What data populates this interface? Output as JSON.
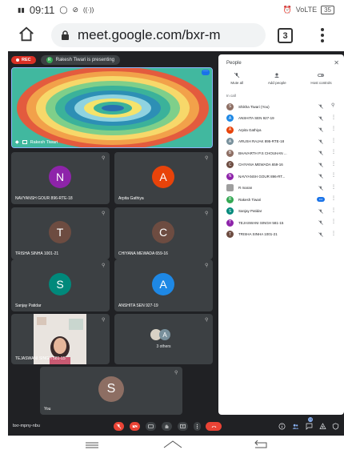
{
  "status_bar": {
    "time": "09:11",
    "left_icons": [
      "signal-icon",
      "whatsapp-icon",
      "shield-icon",
      "hotspot-icon"
    ],
    "right_text": "VoLTE",
    "battery": "35"
  },
  "browser": {
    "url": "meet.google.com/bxr-m",
    "tabs_count": "3"
  },
  "meeting": {
    "rec_label": "REC",
    "presenter_initial": "R",
    "presenting_text": "Rakesh Tiwari is presenting",
    "screen_share_label": "Rakesh Tiwari",
    "meeting_code": "bxr-mpny-nbu"
  },
  "tiles": [
    {
      "name": "NAVYANSH GOUR 896-RTE-18",
      "initial": "N",
      "color": "#8e24aa"
    },
    {
      "name": "Arpita Gathiya",
      "initial": "A",
      "color": "#e8430a"
    },
    {
      "name": "TRISHA SINHA 1001-21",
      "initial": "T",
      "color": "#6d4c41"
    },
    {
      "name": "CHIYANA MEWADA 659-16",
      "initial": "C",
      "color": "#6d4c41"
    },
    {
      "name": "Sanjay Patidar",
      "initial": "S",
      "color": "#00897b"
    },
    {
      "name": "ANSHITA SEN 927-19",
      "initial": "A",
      "color": "#1e88e5"
    },
    {
      "name": "TEJASWANI SINGH 581-15",
      "initial": "",
      "color": ""
    },
    {
      "name": "3 others",
      "initial": "A",
      "color": "#78909c"
    },
    {
      "name": "You",
      "initial": "S",
      "color": "#8d6e63"
    }
  ],
  "people_panel": {
    "title": "People",
    "actions": [
      "Mute all",
      "Add people",
      "Host controls"
    ],
    "section": "In call",
    "participants": [
      {
        "name": "Shikha Tiwari (You)",
        "initial": "S",
        "color": "#8d6e63"
      },
      {
        "name": "ANSHITA SEN 927-19",
        "initial": "A",
        "color": "#1e88e5"
      },
      {
        "name": "Arpita Gathiya",
        "initial": "A",
        "color": "#e8430a"
      },
      {
        "name": "ARUSH RAJAK 895-RTE-18",
        "initial": "A",
        "color": "#78909c"
      },
      {
        "name": "BHAVARTH P.S CHOUHAN ...",
        "initial": "B",
        "color": "#8d6e63"
      },
      {
        "name": "CHIYANA MEWADA 659-16",
        "initial": "C",
        "color": "#6d4c41"
      },
      {
        "name": "NAVYANSH GOUR 896-RT...",
        "initial": "N",
        "color": "#8e24aa"
      },
      {
        "name": "R maran",
        "initial": "",
        "color": "#9e9e9e"
      },
      {
        "name": "Rakesh Tiwari",
        "initial": "R",
        "color": "#34a853"
      },
      {
        "name": "Sanjay Patidar",
        "initial": "S",
        "color": "#00897b"
      },
      {
        "name": "TEJASWANI SINGH 581-15",
        "initial": "T",
        "color": "#8e24aa"
      },
      {
        "name": "TRISHA SINHA 1001-21",
        "initial": "T",
        "color": "#6d4c41"
      }
    ]
  },
  "controls": {
    "participant_badge": "13"
  },
  "colors": {
    "meet_bg": "#202124",
    "tile_bg": "#3c4043",
    "accent": "#1a73e8",
    "danger": "#ea4335"
  }
}
